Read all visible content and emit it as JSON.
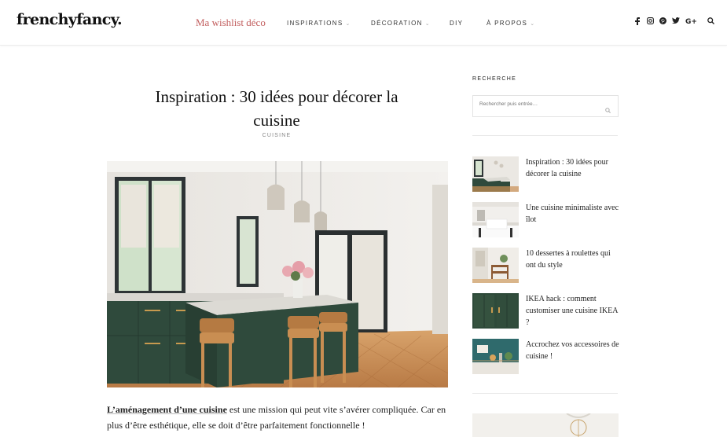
{
  "header": {
    "logo": "frenchyfancy.",
    "wishlist": "Ma wishlist déco",
    "nav": [
      {
        "label": "INSPIRATIONS",
        "has_dropdown": true
      },
      {
        "label": "DÉCORATION",
        "has_dropdown": true
      },
      {
        "label": "DIY",
        "has_dropdown": false
      },
      {
        "label": "À PROPOS",
        "has_dropdown": true
      }
    ],
    "social_icons": [
      "facebook-icon",
      "instagram-icon",
      "pinterest-icon",
      "twitter-icon",
      "google-plus-icon",
      "search-icon"
    ]
  },
  "article": {
    "title_line1": "Inspiration : 30 idées pour décorer la",
    "title_line2": "cuisine",
    "category": "CUISINE",
    "intro_bold": "L’aménagement d’une cuisine",
    "intro_rest": " est une mission qui peut vite s’avérer compliquée. Car en plus d’être esthétique, elle se doit d’être parfaitement fonctionnelle !"
  },
  "sidebar": {
    "search_title": "RECHERCHE",
    "search_placeholder": "Rechercher puis entrée…",
    "posts": [
      {
        "title": "Inspiration : 30 idées pour décorer la cuisine"
      },
      {
        "title": "Une cuisine minimaliste avec îlot"
      },
      {
        "title": "10 dessertes à roulettes qui ont du style"
      },
      {
        "title": "IKEA hack : comment customiser une cuisine IKEA ?"
      },
      {
        "title": "Accrochez vos accessoires de cuisine !"
      }
    ]
  },
  "colors": {
    "wishlist": "#c25e5e",
    "cabinet_green": "#2f4a3c",
    "wood": "#c98e52"
  }
}
